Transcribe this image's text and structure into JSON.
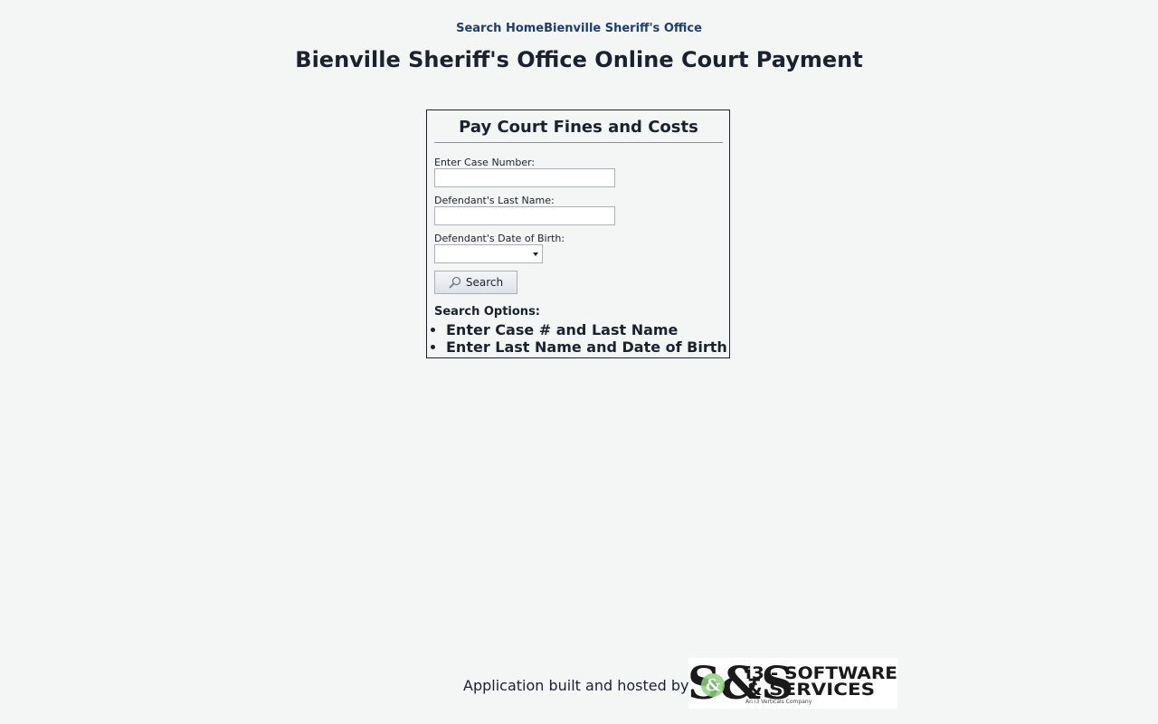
{
  "topnav": {
    "home_link": "Search Home",
    "office_link": "Bienville Sheriff's Office"
  },
  "page_title": "Bienville Sheriff's Office Online Court Payment",
  "panel": {
    "title": "Pay Court Fines and Costs",
    "case_number_label": "Enter Case Number:",
    "case_number_value": "",
    "last_name_label": "Defendant's Last Name:",
    "last_name_value": "",
    "dob_label": "Defendant's Date of Birth:",
    "dob_value": "",
    "search_button_label": "Search",
    "options_heading": "Search Options:",
    "options": [
      "Enter Case # and Last Name",
      "Enter Last Name and Date of Birth"
    ]
  },
  "footer": {
    "text": "Application built and hosted by",
    "logo_text_line1": "i3 - SOFTWARE",
    "logo_text_line2": "& SERVICES",
    "logo_tagline": "An i3 Verticals Company",
    "logo_monogram": "S&S"
  },
  "colors": {
    "background": "#f4f6f5",
    "nav_link": "#1f3d6b",
    "text": "#1a2130",
    "logo_green": "#7cc36e"
  }
}
